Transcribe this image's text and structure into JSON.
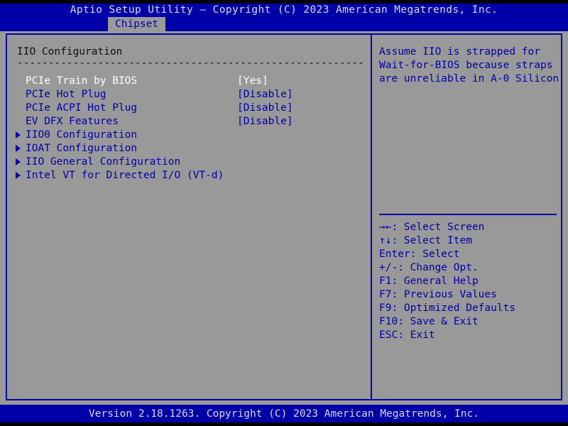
{
  "header": {
    "title": "Aptio Setup Utility – Copyright (C) 2023 American Megatrends, Inc.",
    "active_tab": "Chipset"
  },
  "main": {
    "page_title": "IIO Configuration",
    "separator": "-------------------------------------------------------------",
    "options": [
      {
        "label": "PCIe Train by BIOS",
        "value": "[Yes]",
        "submenu": false,
        "selected": true
      },
      {
        "label": "PCIe Hot Plug",
        "value": "[Disable]",
        "submenu": false,
        "selected": false
      },
      {
        "label": "PCIe ACPI Hot Plug",
        "value": "[Disable]",
        "submenu": false,
        "selected": false
      },
      {
        "label": "EV DFX Features",
        "value": "[Disable]",
        "submenu": false,
        "selected": false
      },
      {
        "label": "IIO0 Configuration",
        "value": "",
        "submenu": true,
        "selected": false
      },
      {
        "label": "IOAT Configuration",
        "value": "",
        "submenu": true,
        "selected": false
      },
      {
        "label": "IIO General Configuration",
        "value": "",
        "submenu": true,
        "selected": false
      },
      {
        "label": "Intel VT for Directed I/O (VT-d)",
        "value": "",
        "submenu": true,
        "selected": false
      }
    ]
  },
  "help": {
    "lines": [
      "Assume IIO is strapped for",
      "Wait-for-BIOS because straps",
      "are unreliable in A-0 Silicon"
    ]
  },
  "legend": {
    "items": [
      {
        "key": "→←",
        "text": ": Select Screen"
      },
      {
        "key": "↑↓",
        "text": ": Select Item"
      },
      {
        "key": "Enter",
        "text": ": Select"
      },
      {
        "key": "+/-",
        "text": ": Change Opt."
      },
      {
        "key": "F1",
        "text": ": General Help"
      },
      {
        "key": "F7",
        "text": ": Previous Values"
      },
      {
        "key": "F9",
        "text": ": Optimized Defaults"
      },
      {
        "key": "F10",
        "text": ": Save & Exit"
      },
      {
        "key": "ESC",
        "text": ": Exit"
      }
    ]
  },
  "footer": {
    "version_text": "Version 2.18.1263. Copyright (C) 2023 American Megatrends, Inc."
  },
  "colors": {
    "header_blue": "#0000a8",
    "background_gray": "#999999",
    "text_blue": "#0000a8",
    "text_white": "#ffffff",
    "text_dark": "#101010",
    "header_text": "#d8d8d8"
  }
}
